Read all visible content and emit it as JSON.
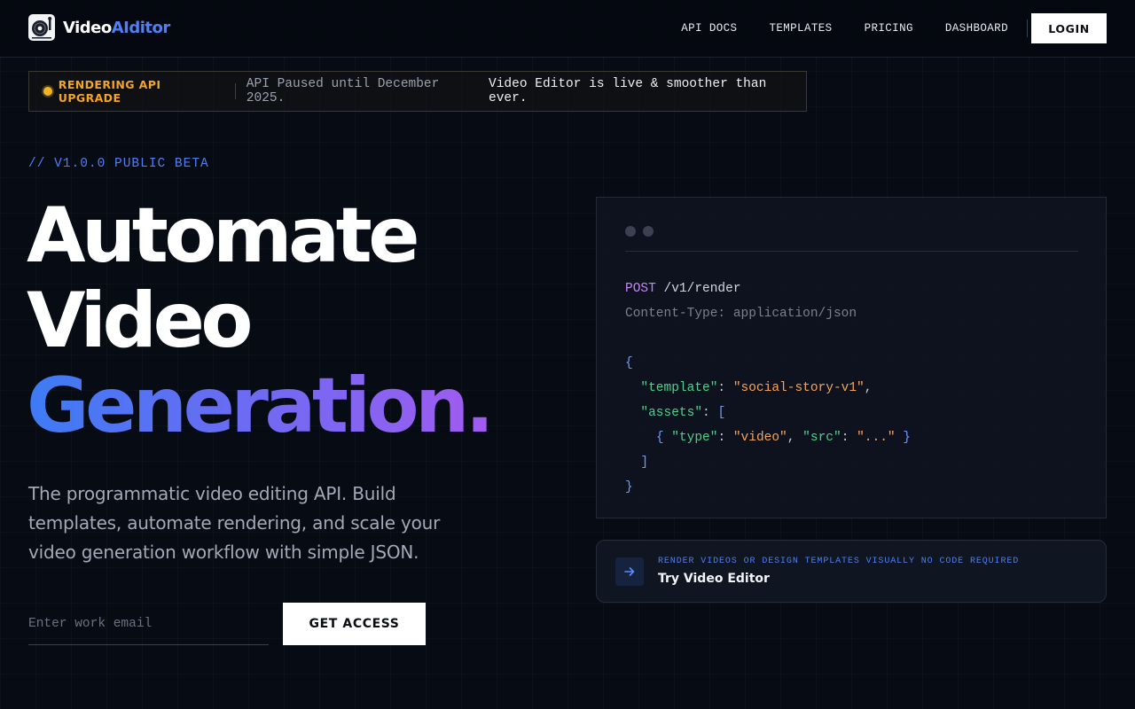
{
  "brand": {
    "name_prefix": "Video",
    "name_accent": "AIditor",
    "accent_color": "#4f80f5"
  },
  "nav": {
    "items": [
      "API DOCS",
      "TEMPLATES",
      "PRICING",
      "DASHBOARD"
    ],
    "login_label": "LOGIN"
  },
  "announcement": {
    "tag": "RENDERING API UPGRADE",
    "text": "API Paused until December 2025.",
    "highlight": "Video Editor is live & smoother than ever.",
    "dot_color": "#f5b324"
  },
  "hero": {
    "version": "// V1.0.0 PUBLIC BETA",
    "headline_line1": "Automate",
    "headline_line2": "Video",
    "headline_line3": "Generation.",
    "subtitle": "The programmatic video editing API. Build templates, automate rendering, and scale your video generation workflow with simple JSON.",
    "email_placeholder": "Enter work email",
    "cta_label": "GET ACCESS"
  },
  "code_panel": {
    "method": "POST",
    "path": "/v1/render",
    "header": "Content-Type: application/json",
    "open_brace": "{",
    "template_key": "\"template\"",
    "template_value": "\"social-story-v1\"",
    "assets_key": "\"assets\"",
    "asset_type_key": "\"type\"",
    "asset_type_value": "\"video\"",
    "asset_src_key": "\"src\"",
    "asset_src_value": "\"...\"",
    "close_bracket": "]",
    "close_brace": "}"
  },
  "editor_card": {
    "kicker": "RENDER VIDEOS OR DESIGN TEMPLATES VISUALLY NO CODE REQUIRED",
    "title": "Try Video Editor",
    "icon": "arrow-right-icon"
  }
}
